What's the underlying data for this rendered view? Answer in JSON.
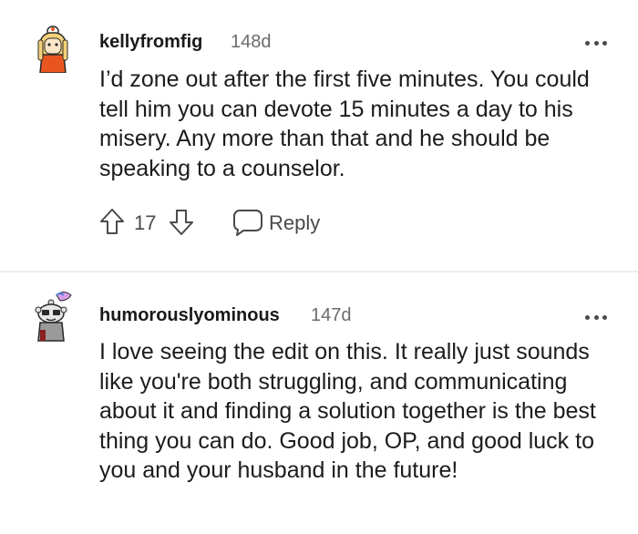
{
  "comments": [
    {
      "username": "kellyfromfig",
      "age": "148d",
      "body": "I’d zone out after the first five minutes. You could tell him you can devote 15 minutes a day to his misery. Any more than that and he should be speaking to a counselor.",
      "score": "17",
      "reply_label": "Reply",
      "avatar_icon": "blonde-avatar-icon"
    },
    {
      "username": "humorouslyominous",
      "age": "147d",
      "body": "I love seeing the edit on this. It really just sounds like you're both struggling, and communicating about it and finding a solution together is the best thing you can do. Good job, OP, and good luck to you and your husband in the future!",
      "avatar_icon": "snoo-avatar-icon"
    }
  ],
  "colors": {
    "text": "#1c1c1c",
    "meta": "#6b6b6b",
    "icon": "#4a4a4a",
    "divider": "#ececec"
  }
}
